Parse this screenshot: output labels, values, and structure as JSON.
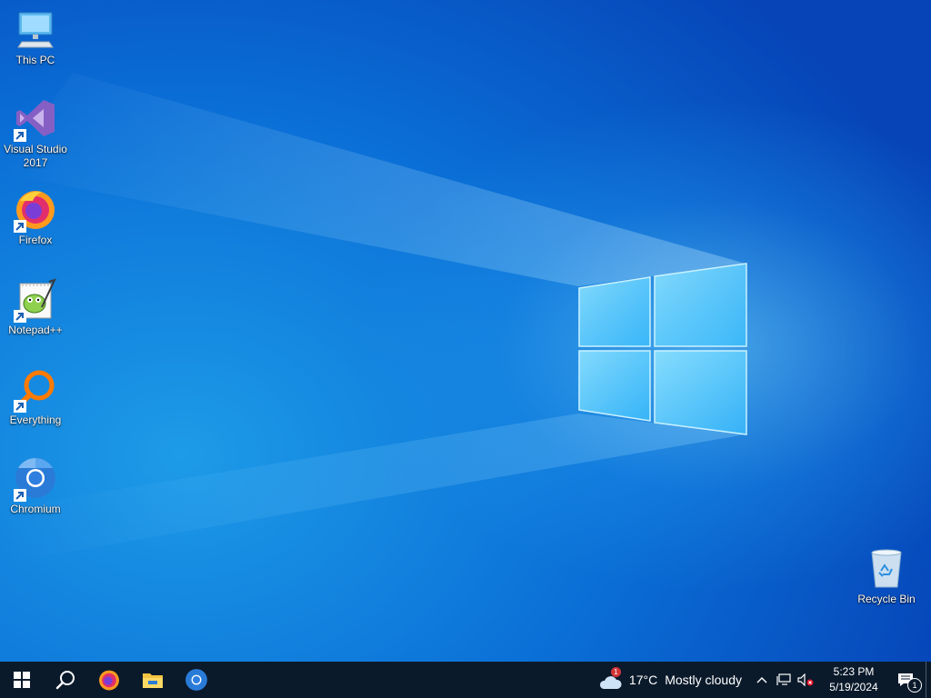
{
  "desktop": {
    "icons": [
      {
        "label": "This PC",
        "icon": "this-pc-icon"
      },
      {
        "label": "Visual Studio 2017",
        "icon": "visual-studio-icon"
      },
      {
        "label": "Firefox",
        "icon": "firefox-icon"
      },
      {
        "label": "Notepad++",
        "icon": "notepad-plus-plus-icon"
      },
      {
        "label": "Everything",
        "icon": "everything-search-icon"
      },
      {
        "label": "Chromium",
        "icon": "chromium-icon"
      },
      {
        "label": "Recycle Bin",
        "icon": "recycle-bin-icon"
      }
    ]
  },
  "taskbar": {
    "pinned": [
      {
        "icon": "windows-start-icon"
      },
      {
        "icon": "search-icon"
      },
      {
        "icon": "firefox-icon"
      },
      {
        "icon": "file-explorer-icon"
      },
      {
        "icon": "chromium-icon"
      }
    ],
    "weather": {
      "icon": "cloudy-weather-icon",
      "badge": "1",
      "temperature": "17°C",
      "condition": "Mostly cloudy"
    },
    "tray": {
      "icons": [
        "chevron-up-icon",
        "network-icon",
        "volume-muted-icon"
      ],
      "time": "5:23 PM",
      "date": "5/19/2024",
      "notification_count": "1"
    }
  },
  "colors": {
    "taskbar_bg": "#0b1a2b",
    "wallpaper_primary": "#0a6ed6",
    "wallpaper_light": "#78dcff"
  }
}
